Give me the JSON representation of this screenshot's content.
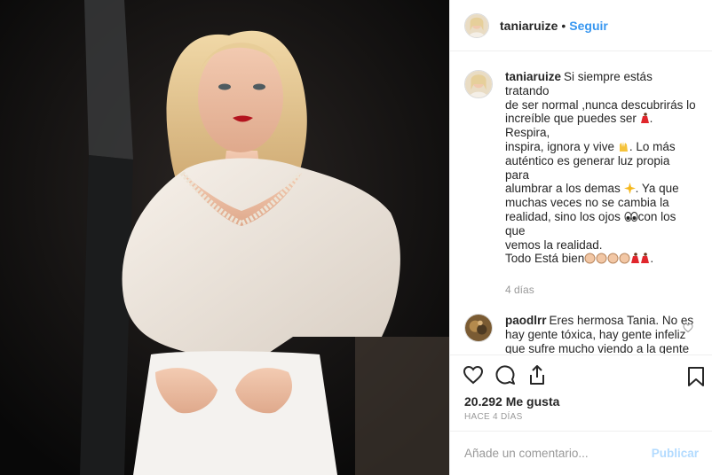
{
  "header": {
    "username": "taniaruize",
    "separator": "•",
    "follow_label": "Seguir"
  },
  "caption": {
    "username": "taniaruize",
    "lines": [
      "Si siempre estás tratando",
      "de ser normal ,nunca descubrirás lo",
      "increíble que puedes ser",
      "Respira,",
      "inspira, ignora y vive",
      ". Lo más",
      "auténtico es generar luz propia para",
      "alumbrar a los demas",
      ". Ya que",
      "muchas veces no se cambia la",
      "realidad, sino los ojos",
      "con los que",
      "vemos la realidad.",
      "Todo Está bien",
      "."
    ],
    "time": "4 días"
  },
  "comment": {
    "username": "paodlrr",
    "text": "Eres hermosa Tania. No es hay gente tóxica, hay gente infeliz que sufre mucho viendo a la gente que feliz disfrutar de la vida. Espero llegar a la edad de nuestro ahora expresidente y tener ese carisma y ganas de"
  },
  "actions": {
    "icons": [
      "heart-icon",
      "comment-icon",
      "share-icon",
      "bookmark-icon"
    ],
    "likes": "20.292 Me gusta",
    "post_date": "HACE 4 DÍAS"
  },
  "add_comment": {
    "placeholder": "Añade un comentario...",
    "publish_label": "Publicar"
  },
  "colors": {
    "link_blue": "#3897f0",
    "publish_disabled": "#b3dbff",
    "muted": "#999999",
    "border": "#efefef"
  }
}
